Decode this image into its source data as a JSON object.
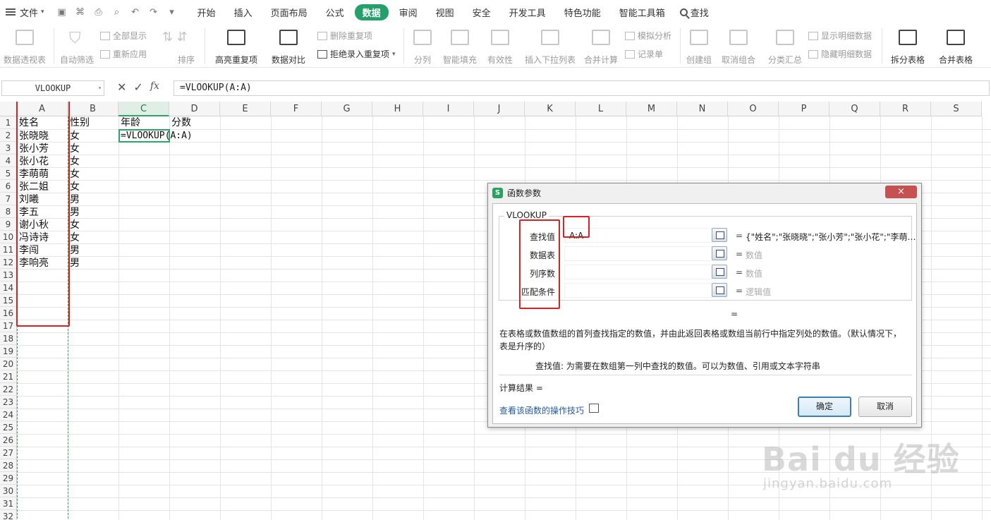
{
  "menubar": {
    "file_label": "文件",
    "tabs": [
      {
        "label": "开始",
        "active": false
      },
      {
        "label": "插入",
        "active": false
      },
      {
        "label": "页面布局",
        "active": false
      },
      {
        "label": "公式",
        "active": false
      },
      {
        "label": "数据",
        "active": true
      },
      {
        "label": "审阅",
        "active": false
      },
      {
        "label": "视图",
        "active": false
      },
      {
        "label": "安全",
        "active": false
      },
      {
        "label": "开发工具",
        "active": false
      },
      {
        "label": "特色功能",
        "active": false
      },
      {
        "label": "智能工具箱",
        "active": false
      }
    ],
    "search_label": "查找",
    "accent_color": "#24a06b"
  },
  "ribbon": {
    "pivot": "数据透视表",
    "autofilter": "自动筛选",
    "show_all": "全部显示",
    "reapply": "重新应用",
    "sort": "排序",
    "highlight_dup": "高亮重复项",
    "compare": "数据对比",
    "remove_dup": "删除重复项",
    "reject_dup": "拒绝录入重复项",
    "split": "分列",
    "smart_fill": "智能填充",
    "validity": "有效性",
    "insert_dropdown": "插入下拉列表",
    "consolidate": "合并计算",
    "what_if": "模拟分析",
    "record": "记录单",
    "create_group": "创建组",
    "ungroup": "取消组合",
    "subtotal": "分类汇总",
    "show_detail": "显示明细数据",
    "hide_detail": "隐藏明细数据",
    "split_table": "拆分表格",
    "merge_table": "合并表格"
  },
  "formula_bar": {
    "name_box": "VLOOKUP",
    "fx": "fx",
    "formula": "=VLOOKUP(A:A)"
  },
  "sheet": {
    "columns": [
      "A",
      "B",
      "C",
      "D",
      "E",
      "F",
      "G",
      "H",
      "I",
      "J",
      "K",
      "L",
      "M",
      "N",
      "O",
      "P",
      "Q",
      "R",
      "S"
    ],
    "selected_column": "C",
    "rows": [
      "1",
      "2",
      "3",
      "4",
      "5",
      "6",
      "7",
      "8",
      "9",
      "10",
      "11",
      "12",
      "13",
      "14",
      "15",
      "16",
      "17",
      "18",
      "19",
      "20",
      "21",
      "22",
      "23",
      "24",
      "25",
      "26",
      "27",
      "28",
      "29",
      "30",
      "31",
      "32"
    ],
    "headers": {
      "a": "姓名",
      "b": "性别",
      "c": "年龄",
      "d": "分数"
    },
    "data": [
      {
        "name": "张晓晓",
        "gender": "女"
      },
      {
        "name": "张小芳",
        "gender": "女"
      },
      {
        "name": "张小花",
        "gender": "女"
      },
      {
        "name": "李萌萌",
        "gender": "女"
      },
      {
        "name": "张二姐",
        "gender": "女"
      },
      {
        "name": "刘曦",
        "gender": "男"
      },
      {
        "name": "李五",
        "gender": "男"
      },
      {
        "name": "谢小秋",
        "gender": "女"
      },
      {
        "name": "冯诗诗",
        "gender": "女"
      },
      {
        "name": "李闯",
        "gender": "男"
      },
      {
        "name": "李响亮",
        "gender": "男"
      }
    ],
    "editing_cell": "=VLOOKUP(A:A)",
    "selection_color": "#2ea46a",
    "highlight_color": "#e02020"
  },
  "dialog": {
    "title": "函数参数",
    "close": "×",
    "function_name": "VLOOKUP",
    "args": [
      {
        "label": "查找值",
        "value": "A:A",
        "result": "{\"姓名\";\"张晓晓\";\"张小芳\";\"张小花\";\"李萌…",
        "hint": false
      },
      {
        "label": "数据表",
        "value": "",
        "result": "数值",
        "hint": true
      },
      {
        "label": "列序数",
        "value": "",
        "result": "数值",
        "hint": true
      },
      {
        "label": "匹配条件",
        "value": "",
        "result": "逻辑值",
        "hint": true
      }
    ],
    "equals": "=",
    "description": "在表格或数值数组的首列查找指定的数值，并由此返回表格或数组当前行中指定列处的数值。（默认情况下，表是升序的）",
    "param_label": "查找值:",
    "param_desc": "为需要在数组第一列中查找的数值。可以为数值、引用或文本字符串",
    "calc_result": "计算结果 =",
    "help_link": "查看该函数的操作技巧",
    "ok": "确定",
    "cancel": "取消"
  },
  "watermark": {
    "brand": "Bai du 经验",
    "url": "jingyan.baidu.com"
  }
}
